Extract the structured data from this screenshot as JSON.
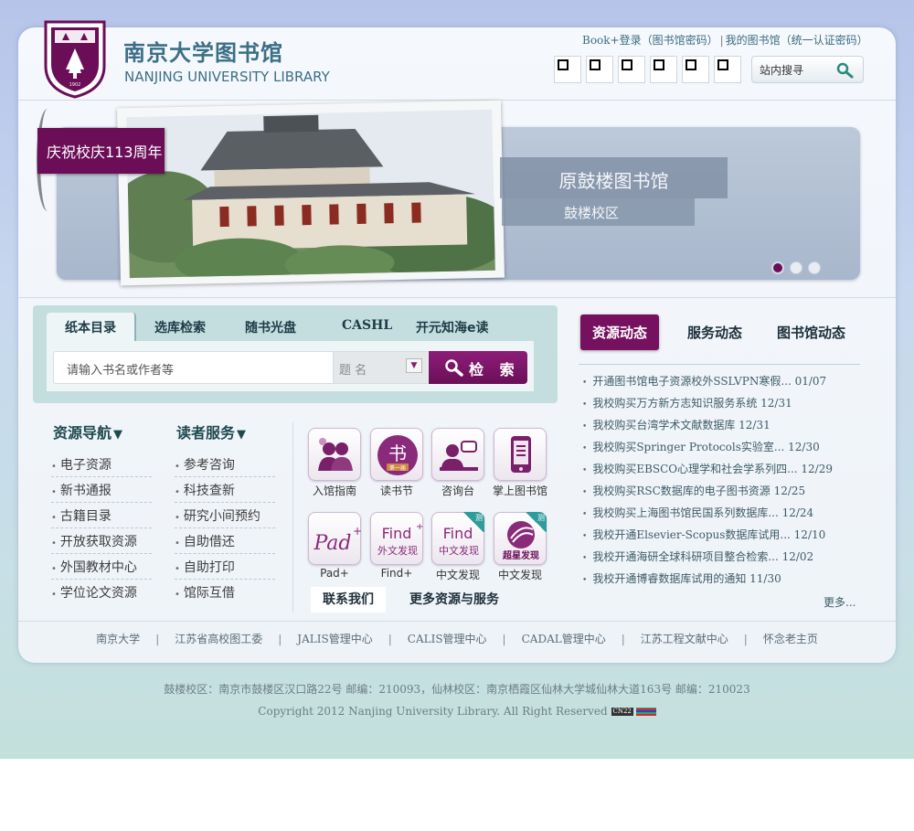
{
  "header": {
    "name_cn": "南京大学图书馆",
    "name_en": "NANJING UNIVERSITY LIBRARY",
    "seal_text": "NANJING UNIVERSITY",
    "seal_year": "1902",
    "login_link": "Book+登录（图书馆密码）",
    "my_library_link": "我的图书馆（统一认证密码）",
    "link_separator": "|",
    "site_search_label": "站内搜寻",
    "qr_codes": [
      "qr-code-1",
      "qr-code-2",
      "qr-code-3",
      "qr-code-4",
      "qr-code-5",
      "qr-code-6"
    ]
  },
  "banner": {
    "tag": "庆祝校庆113周年",
    "title": "原鼓楼图书馆",
    "subtitle": "鼓楼校区",
    "slides_total": 3,
    "active_slide": 1
  },
  "catalog": {
    "tabs": [
      "纸本目录",
      "选库检索",
      "随书光盘",
      "CASHL",
      "开元知海e读"
    ],
    "active_tab": "纸本目录",
    "input_placeholder": "请输入书名或作者等",
    "field_select": "题 名",
    "search_button": "检 索"
  },
  "resource_nav": {
    "title": "资源导航",
    "items": [
      "电子资源",
      "新书通报",
      "古籍目录",
      "开放获取资源",
      "外国教材中心",
      "学位论文资源"
    ]
  },
  "reader_services": {
    "title": "读者服务",
    "items": [
      "参考咨询",
      "科技查新",
      "研究小间预约",
      "自助借还",
      "自助打印",
      "馆际互借"
    ]
  },
  "service_icons": [
    {
      "label": "入馆指南",
      "icon": "people-icon"
    },
    {
      "label": "读书节",
      "icon": "reading-festival-icon",
      "tile_text": "书",
      "tile_sub": "第一届"
    },
    {
      "label": "咨询台",
      "icon": "consultation-icon"
    },
    {
      "label": "掌上图书馆",
      "icon": "mobile-library-icon"
    },
    {
      "label": "Pad+",
      "icon": "pad-icon",
      "tile_text": "Pad"
    },
    {
      "label": "Find+",
      "icon": "find-plus-icon",
      "tile_text": "Find",
      "tile_sub": "外文发现"
    },
    {
      "label": "中文发现",
      "icon": "chinese-discovery-icon",
      "tile_text": "Find",
      "tile_sub": "中文发现",
      "badge": "测"
    },
    {
      "label": "中文发现",
      "icon": "superstar-discovery-icon",
      "tile_sub": "超星发现",
      "badge": "测"
    }
  ],
  "bottom_buttons": {
    "contact": "联系我们",
    "more": "更多资源与服务"
  },
  "news": {
    "tabs": [
      "资源动态",
      "服务动态",
      "图书馆动态"
    ],
    "active_tab": "资源动态",
    "items": [
      "开通图书馆电子资源校外SSLVPN寒假... 01/07",
      "我校购买万方新方志知识服务系统 12/31",
      "我校购买台湾学术文献数据库 12/31",
      "我校购买Springer Protocols实验室... 12/30",
      "我校购买EBSCO心理学和社会学系列四... 12/29",
      "我校购买RSC数据库的电子图书资源 12/25",
      "我校购买上海图书馆民国系列数据库... 12/24",
      "我校开通Elsevier-Scopus数据库试用... 12/10",
      "我校开通海研全球科研项目整合检索... 12/02",
      "我校开通博睿数据库试用的通知 11/30"
    ],
    "more": "更多..."
  },
  "footer": {
    "links": [
      "南京大学",
      "江苏省高校图工委",
      "JALIS管理中心",
      "CALIS管理中心",
      "CADAL管理中心",
      "江苏工程文献中心",
      "怀念老主页"
    ],
    "separator": "|",
    "address": "鼓楼校区：南京市鼓楼区汉口路22号 邮编：210093，仙林校区：南京栖霞区仙林大学城仙林大道163号 邮编：210023",
    "copyright": "Copyright 2012 Nanjing University Library. All Right Reserved",
    "cn22_badge": "CN22"
  },
  "colors": {
    "brand_purple": "#6b0d57",
    "teal_text": "#3c6f87",
    "panel_teal": "#c4dedf"
  }
}
